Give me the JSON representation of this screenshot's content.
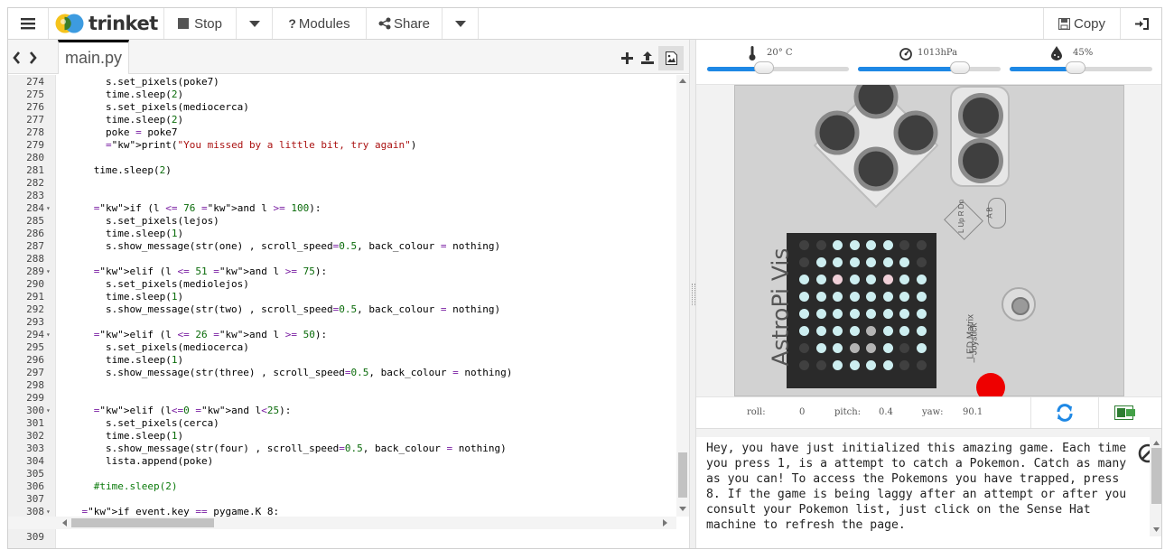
{
  "toolbar": {
    "brand": "trinket",
    "stop_label": "Stop",
    "modules_label": "Modules",
    "share_label": "Share",
    "copy_label": "Copy"
  },
  "editor": {
    "file_tab": "main.py",
    "lines": [
      {
        "n": "274",
        "fold": false,
        "text": "        s.set_pixels(poke7)"
      },
      {
        "n": "275",
        "fold": false,
        "text": "        time.sleep(2)"
      },
      {
        "n": "276",
        "fold": false,
        "text": "        s.set_pixels(mediocerca)"
      },
      {
        "n": "277",
        "fold": false,
        "text": "        time.sleep(2)"
      },
      {
        "n": "278",
        "fold": false,
        "text": "        poke = poke7"
      },
      {
        "n": "279",
        "fold": false,
        "text": "        print(\"You missed by a little bit, try again\")"
      },
      {
        "n": "280",
        "fold": false,
        "text": ""
      },
      {
        "n": "281",
        "fold": false,
        "text": "      time.sleep(2)"
      },
      {
        "n": "282",
        "fold": false,
        "text": ""
      },
      {
        "n": "283",
        "fold": false,
        "text": ""
      },
      {
        "n": "284",
        "fold": true,
        "text": "      if (l <= 76 and l >= 100):"
      },
      {
        "n": "285",
        "fold": false,
        "text": "        s.set_pixels(lejos)"
      },
      {
        "n": "286",
        "fold": false,
        "text": "        time.sleep(1)"
      },
      {
        "n": "287",
        "fold": false,
        "text": "        s.show_message(str(one) , scroll_speed=0.5, back_colour = nothing)"
      },
      {
        "n": "288",
        "fold": false,
        "text": ""
      },
      {
        "n": "289",
        "fold": true,
        "text": "      elif (l <= 51 and l >= 75):"
      },
      {
        "n": "290",
        "fold": false,
        "text": "        s.set_pixels(mediolejos)"
      },
      {
        "n": "291",
        "fold": false,
        "text": "        time.sleep(1)"
      },
      {
        "n": "292",
        "fold": false,
        "text": "        s.show_message(str(two) , scroll_speed=0.5, back_colour = nothing)"
      },
      {
        "n": "293",
        "fold": false,
        "text": ""
      },
      {
        "n": "294",
        "fold": true,
        "text": "      elif (l <= 26 and l >= 50):"
      },
      {
        "n": "295",
        "fold": false,
        "text": "        s.set_pixels(mediocerca)"
      },
      {
        "n": "296",
        "fold": false,
        "text": "        time.sleep(1)"
      },
      {
        "n": "297",
        "fold": false,
        "text": "        s.show_message(str(three) , scroll_speed=0.5, back_colour = nothing)"
      },
      {
        "n": "298",
        "fold": false,
        "text": ""
      },
      {
        "n": "299",
        "fold": false,
        "text": ""
      },
      {
        "n": "300",
        "fold": true,
        "text": "      elif (l<=0 and l<25):"
      },
      {
        "n": "301",
        "fold": false,
        "text": "        s.set_pixels(cerca)"
      },
      {
        "n": "302",
        "fold": false,
        "text": "        time.sleep(1)"
      },
      {
        "n": "303",
        "fold": false,
        "text": "        s.show_message(str(four) , scroll_speed=0.5, back_colour = nothing)"
      },
      {
        "n": "304",
        "fold": false,
        "text": "        lista.append(poke)"
      },
      {
        "n": "305",
        "fold": false,
        "text": ""
      },
      {
        "n": "306",
        "fold": false,
        "text": "      #time.sleep(2)"
      },
      {
        "n": "307",
        "fold": false,
        "text": ""
      },
      {
        "n": "308",
        "fold": true,
        "text": "    if event.key == pygame.K_8:"
      }
    ],
    "last_line": "309"
  },
  "sensors": {
    "temperature": "20° C",
    "pressure": "1013hPa",
    "humidity": "45%",
    "temperature_level": 0.4,
    "pressure_level": 0.72,
    "humidity_level": 0.46
  },
  "hat": {
    "title": "AstroPi Vis",
    "led_label": "LED Matrix",
    "joystick_label": "– Joystick",
    "dpad_labels": "L Up R Dn",
    "ab_label": "A B",
    "leds": [
      "DDCCCCDD",
      "DCCCCCCD",
      "CCPCCPCC",
      "CCCCCCCC",
      "CCCCCCCC",
      "CCCCGCCC",
      "DCCGGCDC",
      "DDCCCCDD"
    ],
    "colors": {
      "C": "#cdeef0",
      "D": "#404040",
      "P": "#f0d0d8",
      "G": "#b4b4b4"
    }
  },
  "orientation": {
    "roll_label": "roll:",
    "roll": "0",
    "pitch_label": "pitch:",
    "pitch": "0.4",
    "yaw_label": "yaw:",
    "yaw": "90.1"
  },
  "console": {
    "text": "Hey, you have just initialized this amazing game. Each time you press 1, is a attempt to catch a Pokemon. Catch as many as you can! To access the Pokemons you have trapped, press 8. If the game is being laggy after an attempt or after you consult your Pokemon list, just click on the Sense Hat machine to refresh the page."
  },
  "accent": "#1e88e5"
}
